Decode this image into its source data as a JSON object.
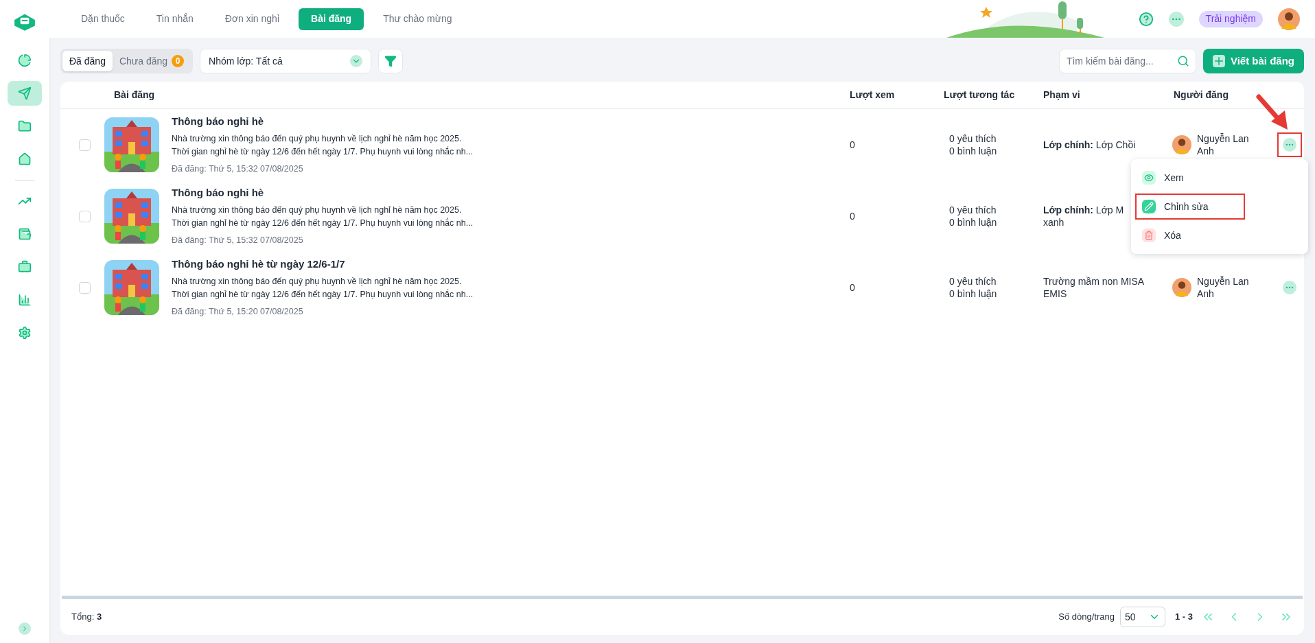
{
  "sidebar": {
    "items": [
      {
        "kind": "pie",
        "selected": false
      },
      {
        "kind": "send",
        "selected": true
      },
      {
        "kind": "folder",
        "selected": false
      },
      {
        "kind": "home",
        "selected": false
      },
      {
        "kind": "chart",
        "selected": false
      },
      {
        "kind": "wallet",
        "selected": false
      },
      {
        "kind": "briefcase",
        "selected": false
      },
      {
        "kind": "bars",
        "selected": false
      },
      {
        "kind": "settings",
        "selected": false
      }
    ]
  },
  "top_tabs": [
    {
      "label": "Dặn thuốc",
      "selected": false
    },
    {
      "label": "Tin nhắn",
      "selected": false
    },
    {
      "label": "Đơn xin nghỉ",
      "selected": false
    },
    {
      "label": "Bài đăng",
      "selected": true
    },
    {
      "label": "Thư chào mừng",
      "selected": false
    }
  ],
  "trial_badge": "Trải nghiệm",
  "status_tabs": [
    {
      "label": "Đã đăng",
      "selected": true
    },
    {
      "label": "Chưa đăng",
      "selected": false,
      "count": "0"
    }
  ],
  "class_filter": "Nhóm lớp: Tất cả",
  "search": {
    "placeholder": "Tìm kiếm bài đăng..."
  },
  "new_post_button": "Viết bài đăng",
  "table": {
    "columns": [
      "Bài đăng",
      "Lượt xem",
      "Lượt tương tác",
      "Phạm vi",
      "Người đăng"
    ],
    "rows": [
      {
        "checked": false,
        "title": "Thông báo nghỉ hè",
        "lines": [
          "Nhà trường xin thông báo đến quý phụ huynh về lịch nghỉ hè năm học 2025.",
          "Thời gian nghỉ hè từ ngày 12/6 đến hết ngày 1/7. Phụ huynh vui lòng nhắc nh..."
        ],
        "posted": "Đã đăng: Thứ 5, 15:32 07/08/2025",
        "views": "0",
        "likes": "0 yêu thích",
        "comments": "0 bình luận",
        "scope": [
          "**Lớp chính:** Lớp Chồi"
        ],
        "author": [
          "Nguyễn Lan",
          "Anh"
        ],
        "annotated": true
      },
      {
        "checked": false,
        "title": "Thông báo nghỉ hè",
        "lines": [
          "Nhà trường xin thông báo đến quý phụ huynh về lịch nghỉ hè năm học 2025.",
          "Thời gian nghỉ hè từ ngày 12/6 đến hết ngày 1/7. Phụ huynh vui lòng nhắc nh..."
        ],
        "posted": "Đã đăng: Thứ 5, 15:32 07/08/2025",
        "views": "0",
        "likes": "0 yêu thích",
        "comments": "0 bình luận",
        "scope": [
          "**Lớp chính:** Lớp M",
          "xanh"
        ],
        "author": [],
        "annotated": false
      },
      {
        "checked": false,
        "title": "Thông báo nghỉ hè từ ngày 12/6-1/7",
        "lines": [
          "Nhà trường xin thông báo đến quý phụ huynh về lịch nghỉ hè năm học 2025.",
          "Thời gian nghỉ hè từ ngày 12/6 đến hết ngày 1/7. Phụ huynh vui lòng nhắc nh..."
        ],
        "posted": "Đã đăng: Thứ 5, 15:20 07/08/2025",
        "views": "0",
        "likes": "0 yêu thích",
        "comments": "0 bình luận",
        "scope": [
          "Trường mầm non MISA",
          "EMIS"
        ],
        "author": [
          "Nguyễn Lan",
          "Anh"
        ],
        "annotated": false
      }
    ]
  },
  "row_menu": {
    "items": [
      {
        "kind": "view",
        "label": "Xem",
        "highlighted": false
      },
      {
        "kind": "edit",
        "label": "Chỉnh sửa",
        "highlighted": true
      },
      {
        "kind": "delete",
        "label": "Xóa",
        "highlighted": false
      }
    ]
  },
  "footer": {
    "total_label": "Tổng:",
    "total": "3",
    "page_size_label": "Số dòng/trang",
    "page_size": "50",
    "range": "1 - 3"
  }
}
